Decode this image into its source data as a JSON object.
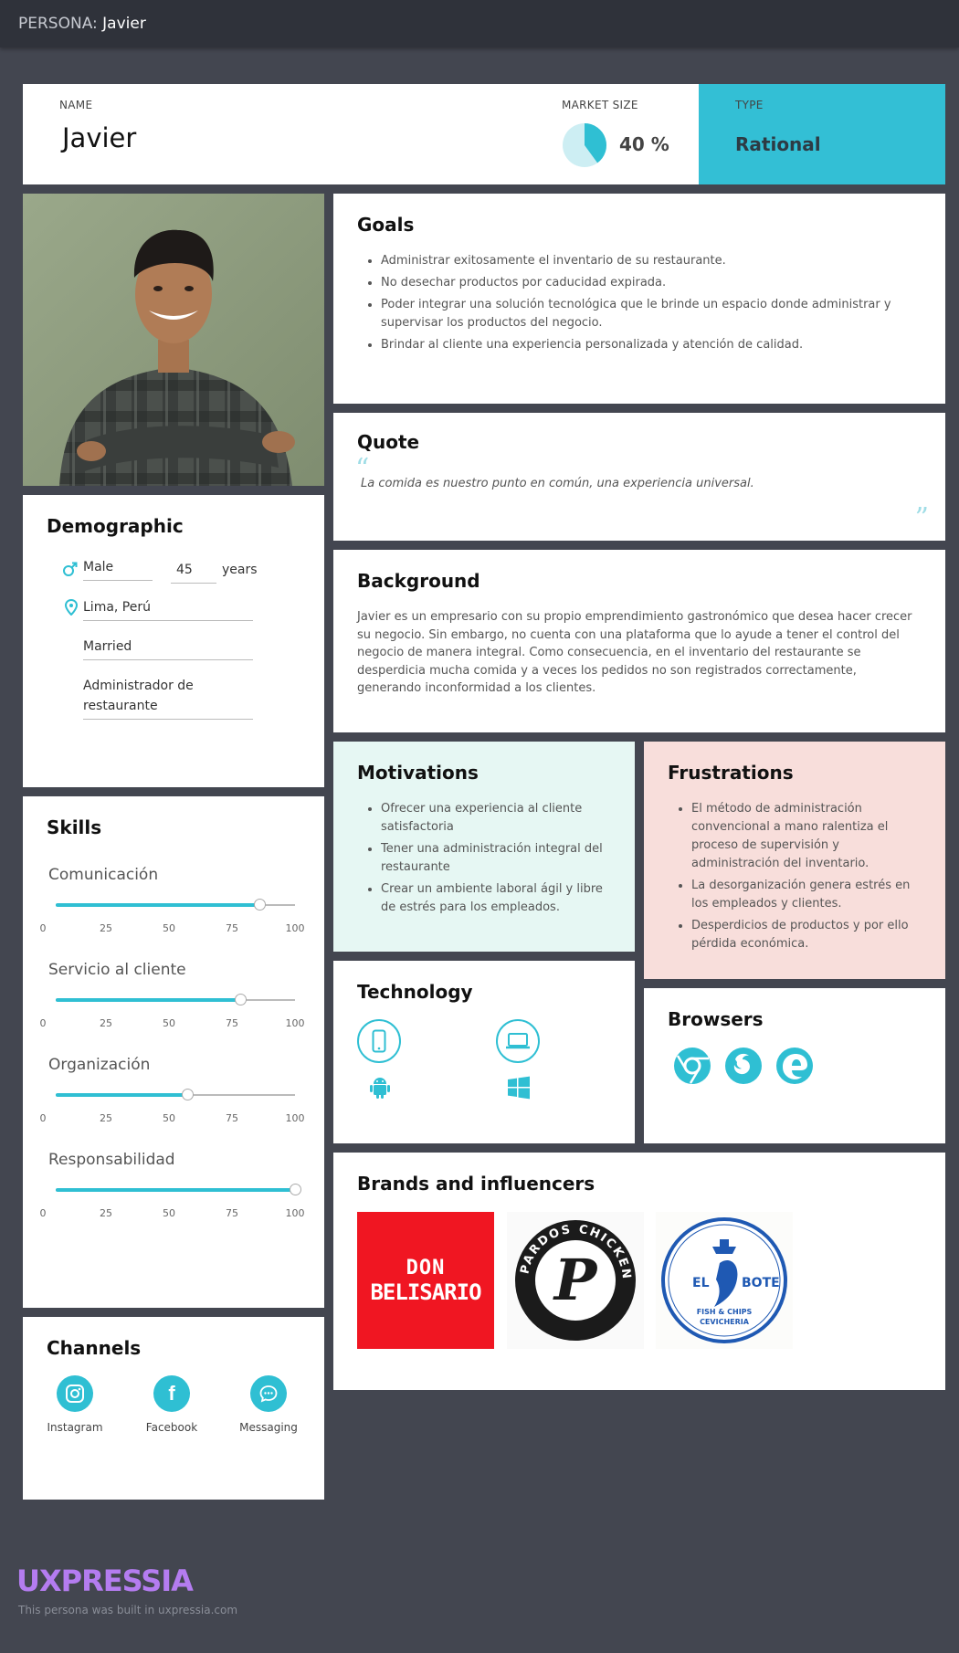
{
  "topbar": {
    "prefix": "PERSONA:",
    "name": "Javier"
  },
  "header": {
    "name_label": "NAME",
    "name": "Javier",
    "market_label": "MARKET SIZE",
    "market_value": "40 %",
    "market_fraction": 0.4,
    "type_label": "TYPE",
    "type_value": "Rational"
  },
  "goals": {
    "title": "Goals",
    "items": [
      "Administrar exitosamente el inventario de su restaurante.",
      "No desechar productos por caducidad expirada.",
      "Poder integrar una solución tecnológica que le brinde un espacio donde administrar y supervisar los productos del negocio.",
      "Brindar al cliente una experiencia personalizada y atención de calidad."
    ]
  },
  "quote": {
    "title": "Quote",
    "text": "La comida es nuestro punto en común, una experiencia universal."
  },
  "background": {
    "title": "Background",
    "text": "Javier es un empresario con su propio emprendimiento gastronómico que desea hacer crecer su negocio. Sin embargo, no cuenta con una plataforma que lo ayude a tener el control del negocio de manera integral. Como consecuencia, en el inventario del restaurante se desperdicia mucha comida y a veces los pedidos no son registrados correctamente, generando inconformidad a los clientes."
  },
  "demographic": {
    "title": "Demographic",
    "gender": "Male",
    "age": "45",
    "age_unit": "years",
    "location": "Lima, Perú",
    "status": "Married",
    "occupation": "Administrador de restaurante"
  },
  "skills": {
    "title": "Skills",
    "ticks": [
      "0",
      "25",
      "50",
      "75",
      "100"
    ],
    "items": [
      {
        "name": "Comunicación",
        "value": 85
      },
      {
        "name": "Servicio al cliente",
        "value": 77
      },
      {
        "name": "Organización",
        "value": 55
      },
      {
        "name": "Responsabilidad",
        "value": 100
      }
    ]
  },
  "channels": {
    "title": "Channels",
    "items": [
      {
        "label": "Instagram",
        "icon": "instagram-icon"
      },
      {
        "label": "Facebook",
        "icon": "facebook-icon"
      },
      {
        "label": "Messaging",
        "icon": "messaging-icon"
      }
    ]
  },
  "motivations": {
    "title": "Motivations",
    "items": [
      "Ofrecer una experiencia al cliente satisfactoria",
      "Tener una administración integral del restaurante",
      "Crear un ambiente laboral ágil y libre de estrés para los empleados."
    ]
  },
  "frustrations": {
    "title": "Frustrations",
    "items": [
      "El método de administración convencional a mano ralentiza el proceso de supervisión y administración del inventario.",
      "La desorganización genera estrés en los empleados y clientes.",
      "Desperdicios de productos y por ello pérdida económica."
    ]
  },
  "technology": {
    "title": "Technology",
    "icons": [
      "mobile-icon",
      "laptop-icon",
      "android-icon",
      "windows-icon"
    ]
  },
  "browsers": {
    "title": "Browsers",
    "icons": [
      "chrome-icon",
      "firefox-icon",
      "edge-icon"
    ]
  },
  "brands": {
    "title": "Brands and influencers",
    "logos": [
      {
        "line1": "DON",
        "line2": "BELISARIO"
      },
      {
        "ring": "PARDOS CHICKEN",
        "mark": "P"
      },
      {
        "left": "EL",
        "right": "BOTE",
        "sub1": "FISH & CHIPS",
        "sub2": "CEVICHERIA"
      }
    ]
  },
  "colors": {
    "accent": "#2fbfd3",
    "motivations_bg": "#e6f7f3",
    "frustrations_bg": "#f8dedb",
    "brand_purple": "#b47cf0"
  },
  "footer": {
    "logo": "UXPRESSIA",
    "note": "This persona was built in uxpressia.com"
  }
}
